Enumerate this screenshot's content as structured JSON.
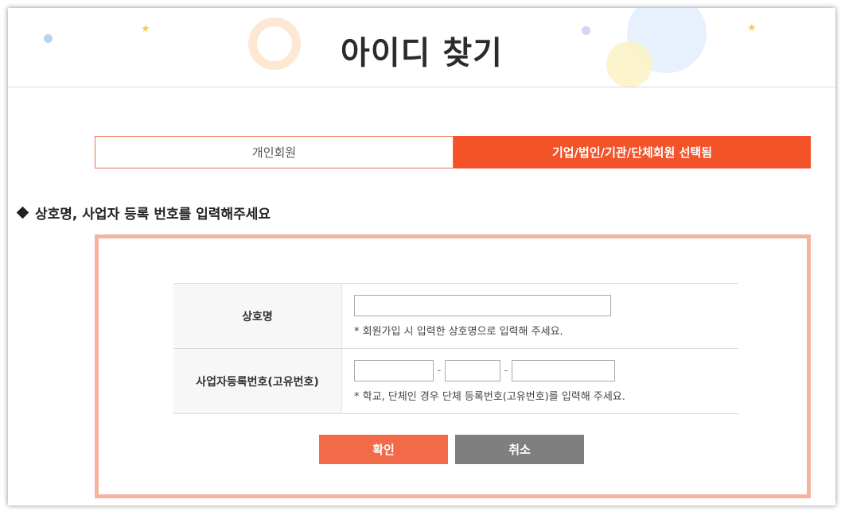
{
  "header": {
    "title": "아이디 찾기"
  },
  "tabs": [
    {
      "label": "개인회원",
      "selected": false
    },
    {
      "label": "기업/법인/기관/단체회원 선택됨",
      "selected": true
    }
  ],
  "section": {
    "heading": "상호명, 사업자 등록 번호를 입력해주세요"
  },
  "form": {
    "company_name": {
      "label": "상호명",
      "value": "",
      "hint": "* 회원가입 시 입력한 상호명으로 입력해 주세요."
    },
    "business_number": {
      "label": "사업자등록번호(고유번호)",
      "part1": "",
      "part2": "",
      "part3": "",
      "separator": "-",
      "hint": "* 학교, 단체인 경우 단체 등록번호(고유번호)를 입력해 주세요."
    }
  },
  "buttons": {
    "confirm": "확인",
    "cancel": "취소"
  },
  "colors": {
    "accent": "#f4532a",
    "confirm_button": "#f26a47",
    "cancel_button": "#7f7f7f",
    "form_border": "#f3b4a0"
  }
}
